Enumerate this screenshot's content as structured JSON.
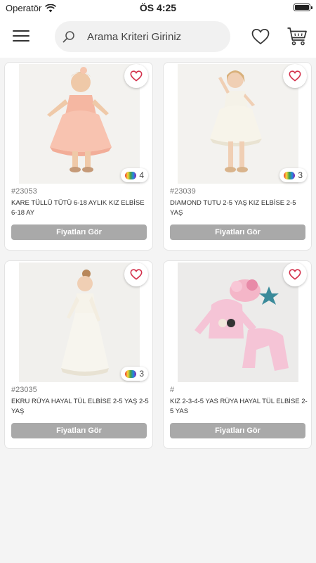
{
  "status_bar": {
    "carrier": "Operatör",
    "time": "ÖS 4:25"
  },
  "header": {
    "search_placeholder": "Arama Kriteri Giriniz"
  },
  "products": [
    {
      "code": "#23053",
      "name": "KARE TÜLLÜ TÜTÜ 6-18 AYLIK KIZ ELBİSE 6-18 AY",
      "color_count": "4",
      "button": "Fiyatları Gör"
    },
    {
      "code": "#23039",
      "name": "DIAMOND TUTU 2-5 YAŞ KIZ ELBİSE 2-5 YAŞ",
      "color_count": "3",
      "button": "Fiyatları Gör"
    },
    {
      "code": "#23035",
      "name": "EKRU RÜYA HAYAL TÜL ELBİSE 2-5 YAŞ 2-5 YAŞ",
      "color_count": "3",
      "button": "Fiyatları Gör"
    },
    {
      "code": "#",
      "name": "KIZ 2-3-4-5 YAS RÜYA HAYAL TÜL ELBİSE 2-5 YAS",
      "color_count": null,
      "button": "Fiyatları Gör"
    }
  ],
  "colors": {
    "accent": "#d32f4a",
    "button_bg": "#a9a9a9",
    "page_bg": "#f4f4f4"
  },
  "icons": [
    "menu-icon",
    "search-icon",
    "heart-outline-icon",
    "cart-icon",
    "color-palette-icon"
  ]
}
